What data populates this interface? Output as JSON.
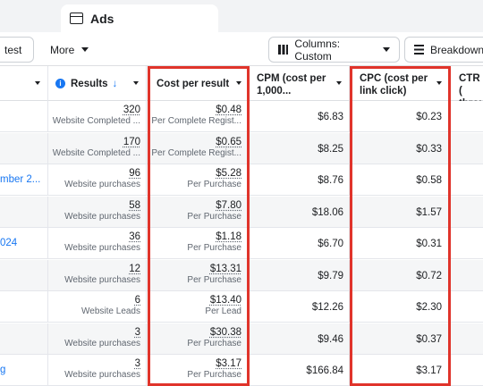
{
  "tab": {
    "label": "Ads"
  },
  "toolbar": {
    "test_label": "test",
    "more_label": "More",
    "columns_label": "Columns: Custom",
    "breakdown_label": "Breakdown"
  },
  "headers": {
    "results": "Results",
    "cost_per_result": "Cost per result",
    "cpm_line1": "CPM (cost per",
    "cpm_line2": "1,000...",
    "cpc_line1": "CPC (cost per",
    "cpc_line2": "link click)",
    "ctr_line1": "CTR (",
    "ctr_line2": "throu"
  },
  "rows": [
    {
      "name": "",
      "results": "320",
      "results_type": "Website Completed ...",
      "cpr": "$0.48",
      "cpr_type": "Per Complete Regist...",
      "cpm": "$6.83",
      "cpc": "$0.23"
    },
    {
      "name": "",
      "results": "170",
      "results_type": "Website Completed ...",
      "cpr": "$0.65",
      "cpr_type": "Per Complete Regist...",
      "cpm": "$8.25",
      "cpc": "$0.33"
    },
    {
      "name": "mber 2...",
      "results": "96",
      "results_type": "Website purchases",
      "cpr": "$5.28",
      "cpr_type": "Per Purchase",
      "cpm": "$8.76",
      "cpc": "$0.58"
    },
    {
      "name": "",
      "results": "58",
      "results_type": "Website purchases",
      "cpr": "$7.80",
      "cpr_type": "Per Purchase",
      "cpm": "$18.06",
      "cpc": "$1.57"
    },
    {
      "name": "024",
      "results": "36",
      "results_type": "Website purchases",
      "cpr": "$1.18",
      "cpr_type": "Per Purchase",
      "cpm": "$6.70",
      "cpc": "$0.31"
    },
    {
      "name": "",
      "results": "12",
      "results_type": "Website purchases",
      "cpr": "$13.31",
      "cpr_type": "Per Purchase",
      "cpm": "$9.79",
      "cpc": "$0.72"
    },
    {
      "name": "",
      "results": "6",
      "results_type": "Website Leads",
      "cpr": "$13.40",
      "cpr_type": "Per Lead",
      "cpm": "$12.26",
      "cpc": "$2.30"
    },
    {
      "name": "",
      "results": "3",
      "results_type": "Website purchases",
      "cpr": "$30.38",
      "cpr_type": "Per Purchase",
      "cpm": "$9.46",
      "cpc": "$0.37"
    },
    {
      "name": "g",
      "results": "3",
      "results_type": "Website purchases",
      "cpr": "$3.17",
      "cpr_type": "Per Purchase",
      "cpm": "$166.84",
      "cpc": "$3.17"
    }
  ],
  "colors": {
    "highlight": "#e0342b",
    "link": "#1877f2"
  }
}
